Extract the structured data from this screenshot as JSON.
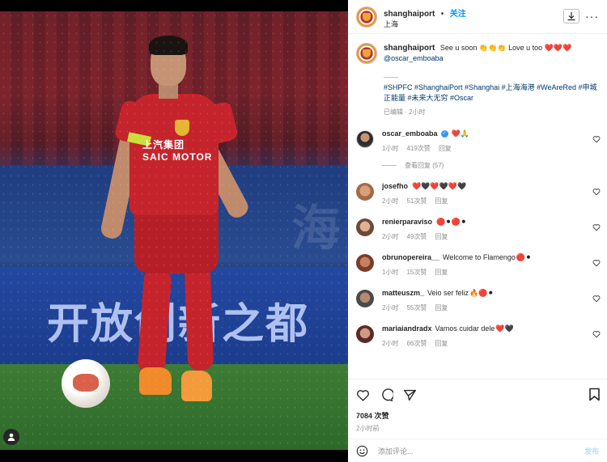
{
  "media": {
    "banner_text": "开放创新之都"
  },
  "post": {
    "username": "shanghaiport",
    "separator": "•",
    "follow_label": "关注",
    "location": "上海",
    "caption": {
      "text": "See u soon",
      "emoji1": "👏👏👏",
      "text2": "Love u too",
      "hearts": "❤️❤️❤️",
      "mention": "@oscar_emboaba",
      "divider": "——",
      "tags": "#SHPFC #ShanghaiPort #Shanghai #上海海港 #WeAreRed #申城正能量 #未来大无穷 #Oscar",
      "meta": "已编辑 · 2小时"
    },
    "likes": "7084 次赞",
    "posted": "2小时前",
    "add_comment_placeholder": "添加评论...",
    "post_button": "发布"
  },
  "comments": [
    {
      "username": "oscar_emboaba",
      "verified": true,
      "text": "",
      "emoji": "❤️🙏",
      "time": "1小时",
      "likes": "419次赞",
      "reply": "回复",
      "avatar_color": "#3a3a3a"
    },
    {
      "username": "josefho",
      "verified": false,
      "text": "",
      "emoji": "❤️🖤❤️🖤❤️🖤",
      "time": "2小时",
      "likes": "51次赞",
      "reply": "回复",
      "avatar_color": "#a26a48"
    },
    {
      "username": "renierparaviso",
      "verified": false,
      "text": "",
      "emoji": "🔴⚫🔴⚫",
      "time": "2小时",
      "likes": "49次赞",
      "reply": "回复",
      "avatar_color": "#6b4a3a"
    },
    {
      "username": "obrunopereira__",
      "verified": false,
      "text": "Welcome to Flamengo",
      "emoji": "🔴⚫",
      "time": "1小时",
      "likes": "15次赞",
      "reply": "回复",
      "avatar_color": "#7a3d2a"
    },
    {
      "username": "matteuszm_",
      "verified": false,
      "text": "Veio ser feliz",
      "emoji": "🔥🔴⚫",
      "time": "2小时",
      "likes": "55次赞",
      "reply": "回复",
      "avatar_color": "#4a4a4a"
    },
    {
      "username": "mariaiandradx",
      "verified": false,
      "text": "Vamos cuidar dele",
      "emoji": "❤️🖤",
      "time": "2小时",
      "likes": "66次赞",
      "reply": "回复",
      "avatar_color": "#5a2a2a"
    }
  ],
  "view_replies": "查看回复 (57)"
}
